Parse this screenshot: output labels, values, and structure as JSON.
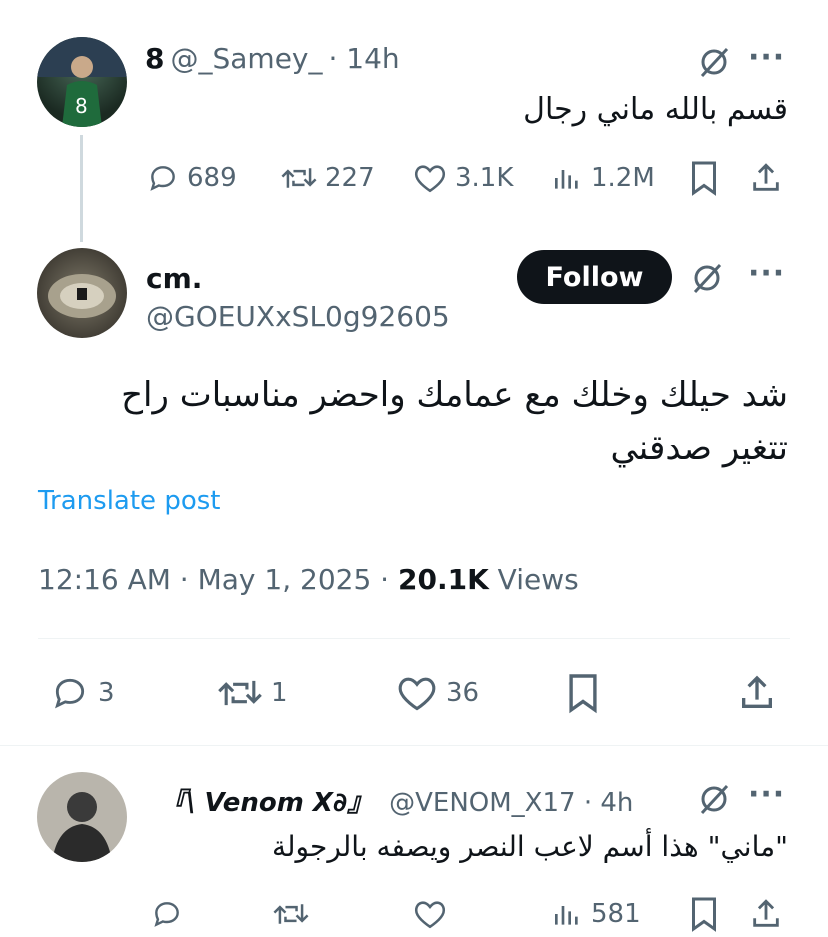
{
  "tweet1": {
    "display_name": "8",
    "handle": "@_Samey_",
    "time": "· 14h",
    "text": "قسم بالله ماني رجال",
    "replies": "689",
    "retweets": "227",
    "likes": "3.1K",
    "views": "1.2M"
  },
  "tweet2": {
    "display_name": "cm.",
    "handle": "@GOEUXxSL0g92605",
    "follow_label": "Follow",
    "text_line1": "شد حيلك وخلك مع عمامك واحضر مناسبات راح",
    "text_line2": "تتغير صدقني",
    "translate_label": "Translate post",
    "timestamp": "12:16 AM · May 1, 2025 ·",
    "views_count": "20.1K",
    "views_label": "Views",
    "replies": "3",
    "retweets": "1",
    "likes": "36"
  },
  "tweet3": {
    "display_name": "『\\ Venom X∂』",
    "handle": "@VENOM_X17 · 4h",
    "text": "\"ماني\" هذا أسم لاعب النصر ويصفه بالرجولة",
    "views": "581"
  },
  "icons": [
    "grok-icon",
    "more-icon",
    "reply-icon",
    "retweet-icon",
    "like-icon",
    "views-icon",
    "bookmark-icon",
    "share-icon"
  ],
  "colors": {
    "text": "#0f1419",
    "secondary": "#536471",
    "link": "#1d9bf0",
    "follow_bg": "#0f1419"
  }
}
